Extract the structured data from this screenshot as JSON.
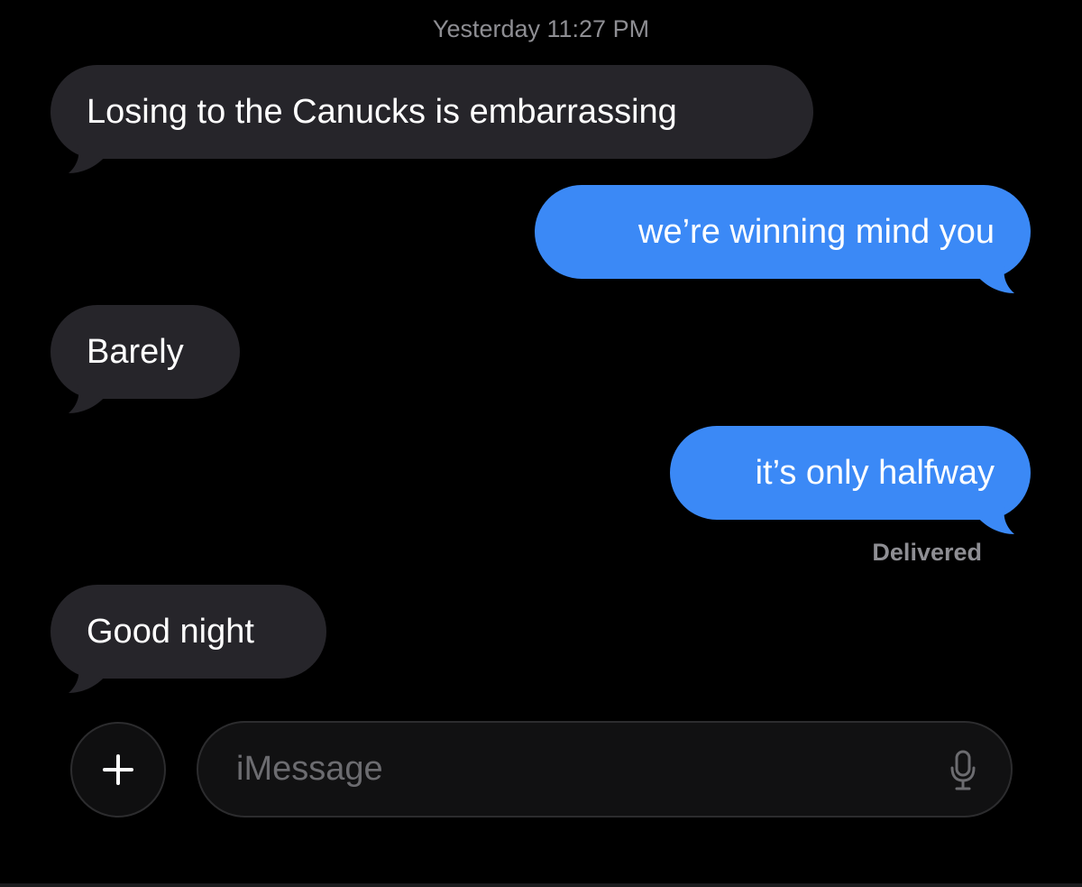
{
  "conversation": {
    "timestamp": "Yesterday 11:27 PM",
    "messages": [
      {
        "direction": "incoming",
        "text": "Losing to the Canucks is embarrassing"
      },
      {
        "direction": "outgoing",
        "text": "we’re winning mind you"
      },
      {
        "direction": "incoming",
        "text": "Barely"
      },
      {
        "direction": "outgoing",
        "text": "it’s only halfway"
      },
      {
        "direction": "incoming",
        "text": "Good night"
      }
    ],
    "delivery_status": "Delivered"
  },
  "composer": {
    "placeholder": "iMessage",
    "value": "",
    "add_icon": "plus-icon",
    "dictation_icon": "microphone-icon"
  },
  "colors": {
    "background": "#000000",
    "incoming_bubble": "#26252a",
    "outgoing_bubble": "#3b89f6",
    "secondary_text": "#8e8e93"
  }
}
